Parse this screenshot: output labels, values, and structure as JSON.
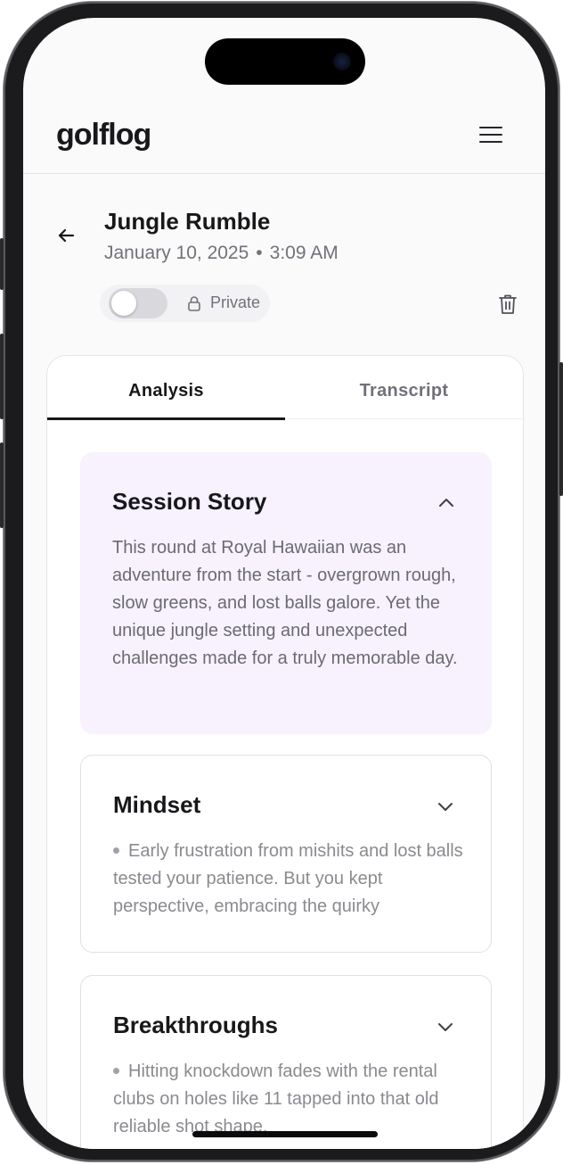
{
  "app": {
    "logo": "golflog"
  },
  "round": {
    "title": "Jungle Rumble",
    "date": "January 10, 2025",
    "separator": "•",
    "time": "3:09 AM",
    "privacy_label": "Private",
    "privacy_on": false
  },
  "tabs": [
    {
      "label": "Analysis",
      "active": true
    },
    {
      "label": "Transcript",
      "active": false
    }
  ],
  "sections": {
    "story": {
      "title": "Session Story",
      "expanded": true,
      "body": "This round at Royal Hawaiian was an adventure from the start - overgrown rough, slow greens, and lost balls galore. Yet the unique jungle setting and unexpected challenges made for a truly memorable day."
    },
    "mindset": {
      "title": "Mindset",
      "expanded": false,
      "bullet": "Early frustration from mishits and lost balls tested your patience. But you kept perspective, embracing the quirky"
    },
    "breakthroughs": {
      "title": "Breakthroughs",
      "expanded": false,
      "bullet": "Hitting knockdown fades with the rental clubs on holes like 11 tapped into that old reliable shot shape."
    }
  },
  "icons": {
    "menu": "hamburger-menu-icon",
    "back": "arrow-left-icon",
    "lock": "lock-icon",
    "trash": "trash-icon",
    "chevron_up": "chevron-up-icon",
    "chevron_down": "chevron-down-icon"
  },
  "colors": {
    "accent_story_bg": "#f7f2fd",
    "text_primary": "#18181b",
    "text_muted": "#71717a"
  }
}
